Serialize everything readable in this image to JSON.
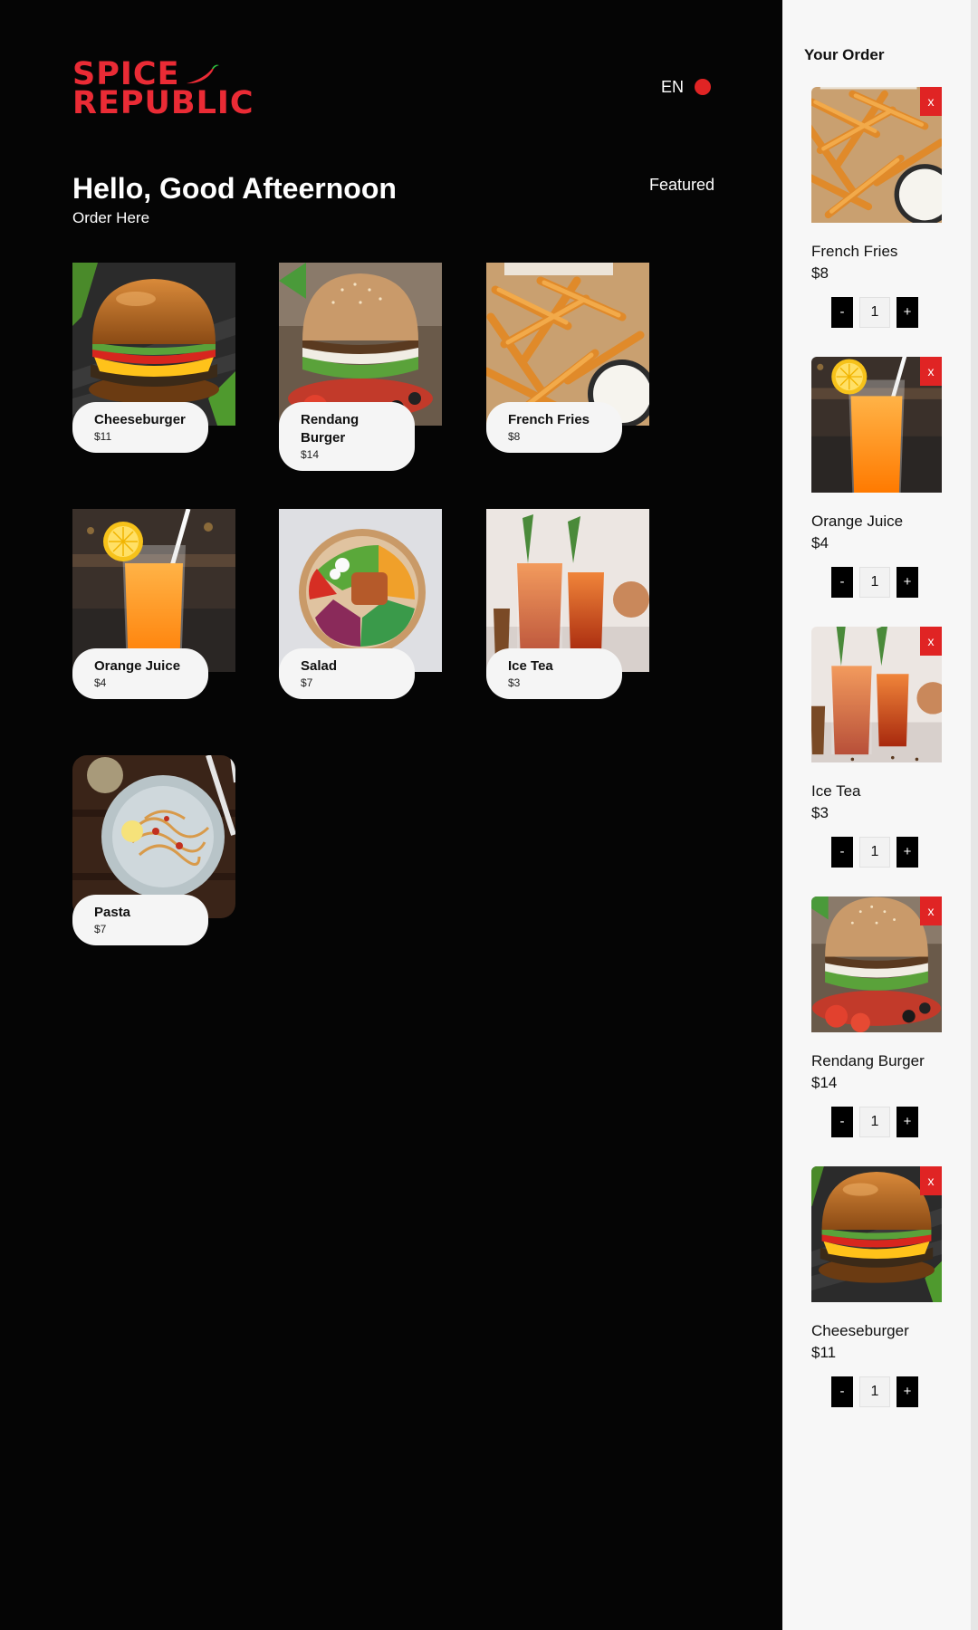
{
  "brand": {
    "line1": "SPICE",
    "line2": "REPUBLIC",
    "color": "#ea2b35"
  },
  "header": {
    "language": "EN"
  },
  "hero": {
    "greeting": "Hello, Good Afteernoon",
    "subtitle": "Order Here",
    "featured": "Featured"
  },
  "menu": [
    {
      "name": "Cheeseburger",
      "price": "$11",
      "image": "cheeseburger"
    },
    {
      "name": "Rendang Burger",
      "price": "$14",
      "image": "rendang-burger"
    },
    {
      "name": "French Fries",
      "price": "$8",
      "image": "french-fries"
    },
    {
      "name": "Orange Juice",
      "price": "$4",
      "image": "orange-juice"
    },
    {
      "name": "Salad",
      "price": "$7",
      "image": "salad"
    },
    {
      "name": "Ice Tea",
      "price": "$3",
      "image": "ice-tea"
    },
    {
      "name": "Pasta",
      "price": "$7",
      "image": "pasta"
    }
  ],
  "order": {
    "title": "Your Order",
    "remove_label": "x",
    "minus_label": "-",
    "plus_label": "+",
    "items": [
      {
        "name": "French Fries",
        "price": "$8",
        "qty": "1",
        "image": "french-fries"
      },
      {
        "name": "Orange Juice",
        "price": "$4",
        "qty": "1",
        "image": "orange-juice"
      },
      {
        "name": "Ice Tea",
        "price": "$3",
        "qty": "1",
        "image": "ice-tea"
      },
      {
        "name": "Rendang Burger",
        "price": "$14",
        "qty": "1",
        "image": "rendang-burger"
      },
      {
        "name": "Cheeseburger",
        "price": "$11",
        "qty": "1",
        "image": "cheeseburger"
      }
    ]
  },
  "colors": {
    "background": "#050505",
    "accent": "#e02424",
    "sidebar": "#f7f7f7",
    "pill": "#f5f5f5"
  }
}
